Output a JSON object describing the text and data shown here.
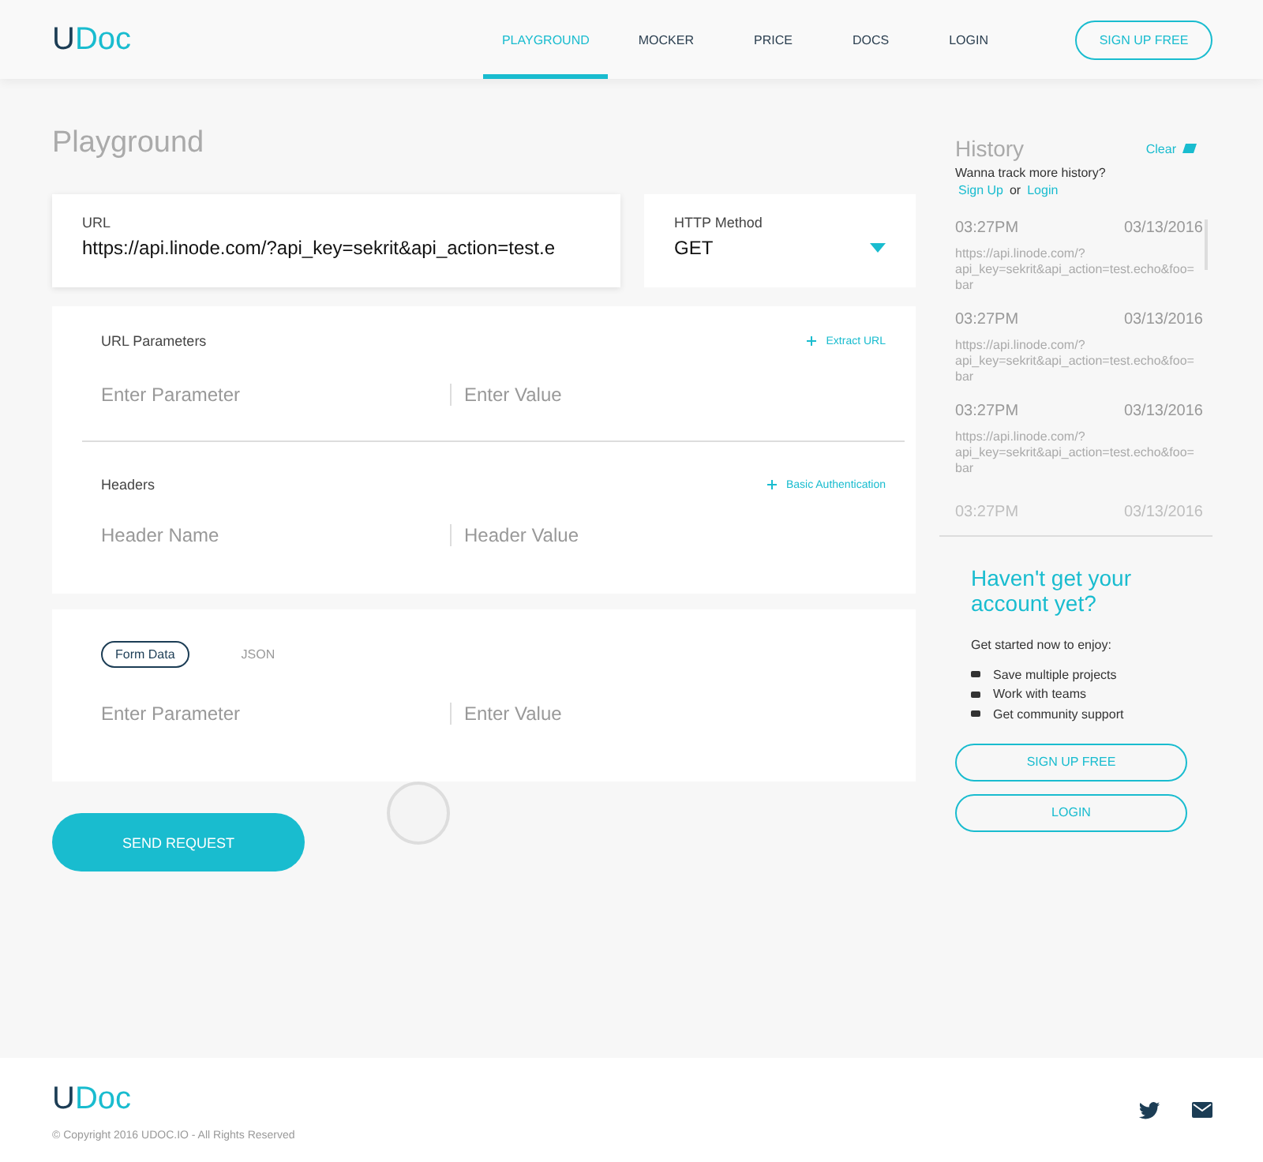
{
  "logo": {
    "mark": "U",
    "name": "Doc"
  },
  "nav": [
    {
      "label": "PLAYGROUND",
      "selected": true
    },
    {
      "label": "MOCKER",
      "selected": false
    },
    {
      "label": "PRICE",
      "selected": false
    },
    {
      "label": "DOCS",
      "selected": false
    },
    {
      "label": "LOGIN",
      "selected": false
    }
  ],
  "signup_button": "SIGN UP FREE",
  "page_title": "Playground",
  "url": {
    "label": "URL",
    "value": "https://api.linode.com/?api_key=sekrit&api_action=test.e"
  },
  "method": {
    "label": "HTTP Method",
    "value": "GET"
  },
  "url_params": {
    "title": "URL Parameters",
    "action": "Extract URL",
    "key_placeholder": "Enter Parameter",
    "value_placeholder": "Enter Value"
  },
  "headers": {
    "title": "Headers",
    "action": "Basic Authentication",
    "key_placeholder": "Header Name",
    "value_placeholder": "Header Value"
  },
  "body": {
    "tabs": [
      {
        "label": "Form Data",
        "selected": true
      },
      {
        "label": "JSON",
        "selected": false
      }
    ],
    "key_placeholder": "Enter Parameter",
    "value_placeholder": "Enter Value"
  },
  "send_button": "SEND REQUEST",
  "history": {
    "title": "History",
    "clear": "Clear",
    "prompt": "Wanna track more history?",
    "signup_link": "Sign Up",
    "or": "or",
    "login_link": "Login",
    "entries": [
      {
        "time": "03:27PM",
        "date": "03/13/2016",
        "url": "https://api.linode.com/?api_key=sekrit&api_action=test.echo&foo=bar",
        "faded": false
      },
      {
        "time": "03:27PM",
        "date": "03/13/2016",
        "url": "https://api.linode.com/?api_key=sekrit&api_action=test.echo&foo=bar",
        "faded": false
      },
      {
        "time": "03:27PM",
        "date": "03/13/2016",
        "url": "https://api.linode.com/?api_key=sekrit&api_action=test.echo&foo=bar",
        "faded": false
      },
      {
        "time": "03:27PM",
        "date": "03/13/2016",
        "faded": true
      }
    ]
  },
  "promo": {
    "title": "Haven't get your account yet?",
    "intro": "Get started now to enjoy:",
    "features": [
      "Save multiple projects",
      "Work with teams",
      "Get community support"
    ],
    "signup_button": "SIGN UP FREE",
    "login_button": "LOGIN"
  },
  "footer": {
    "logo": {
      "mark": "U",
      "name": "Doc"
    },
    "copyright": "© Copyright 2016 UDOC.IO - All Rights Reserved"
  }
}
